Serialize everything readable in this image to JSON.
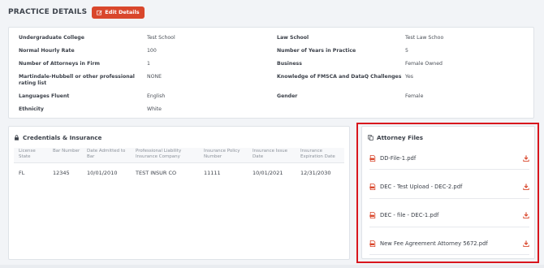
{
  "header": {
    "title": "PRACTICE DETAILS",
    "edit_label": "Edit Details"
  },
  "practice": {
    "rows": [
      [
        {
          "label": "Undergraduate College",
          "value": "Test School"
        },
        {
          "label": "Law School",
          "value": "Test Law Schoo"
        }
      ],
      [
        {
          "label": "Normal Hourly Rate",
          "value": "100"
        },
        {
          "label": "Number of Years in Practice",
          "value": "5"
        }
      ],
      [
        {
          "label": "Number of Attorneys in Firm",
          "value": "1"
        },
        {
          "label": "Business",
          "value": "Female Owned"
        }
      ],
      [
        {
          "label": "Martindale-Hubbell or other professional rating list",
          "value": "NONE"
        },
        {
          "label": "Knowledge of FMSCA and DataQ Challenges",
          "value": "Yes"
        }
      ],
      [
        {
          "label": "Languages Fluent",
          "value": "English"
        },
        {
          "label": "Gender",
          "value": "Female"
        }
      ],
      [
        {
          "label": "Ethnicity",
          "value": "White"
        },
        {
          "label": "",
          "value": ""
        }
      ]
    ]
  },
  "credentials": {
    "title": "Credentials & Insurance",
    "headers": [
      "License State",
      "Bar Number",
      "Date Admitted to Bar",
      "Professional Liability Insurance Company",
      "Insurance Policy Number",
      "Insurance Issue Date",
      "Insurance Expiration Date"
    ],
    "row": [
      "FL",
      "12345",
      "10/01/2010",
      "TEST INSUR CO",
      "11111",
      "10/01/2021",
      "12/31/2030"
    ]
  },
  "files": {
    "title": "Attorney Files",
    "items": [
      "DD-File-1.pdf",
      "DEC - Test Upload - DEC-2.pdf",
      "DEC - file - DEC-1.pdf",
      "New Fee Agreement Attorney 5672.pdf"
    ]
  },
  "colors": {
    "accent": "#d9472c",
    "highlight": "#d8161d"
  }
}
